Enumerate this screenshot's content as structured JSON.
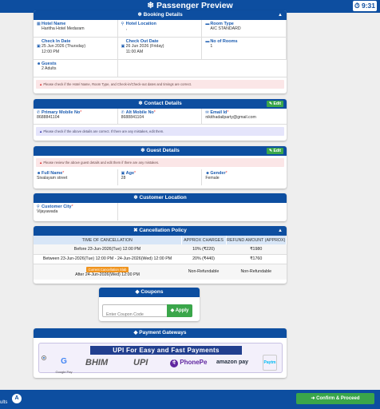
{
  "header": {
    "title": "❄ Passenger Preview",
    "timer": "9:31"
  },
  "booking": {
    "heading": "❄ Booking Details",
    "hotel_name_label": "Hotel Name",
    "hotel_name": "Haritha Hotel Medaram",
    "hotel_location_label": "Hotel Location",
    "hotel_location": ",",
    "room_type_label": "Room Type",
    "room_type": "A/C STANDARD",
    "checkin_label": "Check In Date",
    "checkin_date": "25 Jun 2026 (Thursday)",
    "checkin_time": "12:00 PM",
    "checkout_label": "Check Out Date",
    "checkout_date": "26 Jun 2026 (Friday)",
    "checkout_time": "11:00 AM",
    "rooms_label": "No of Rooms",
    "rooms": "1",
    "guests_label": "Guests",
    "guests": "2 Adults",
    "note": "Please check if the Hotel Name, Room Type, and Check-in/Check-out dates and timings are correct."
  },
  "contact": {
    "heading": "❄ Contact Details",
    "edit": "Edit",
    "mobile_label": "Primary Mobile No",
    "mobile": "8688841104",
    "alt_label": "Alt Mobile No",
    "alt": "8688841104",
    "email_label": "Email Id",
    "email": "nikithadailparty@gmail.com",
    "note": "Please check if the above details are correct. If there are any mistakes, edit them."
  },
  "guest": {
    "heading": "❄ Guest Details",
    "edit": "Edit",
    "note": "Please review the above guest details and edit them if there are any mistakes.",
    "name_label": "Full Name",
    "name": "Sivalayam street",
    "age_label": "Age",
    "age": "28",
    "gender_label": "Gender",
    "gender": "Female"
  },
  "location": {
    "heading": "❄ Customer Location",
    "city_label": "Customer City",
    "city": "Vijayawada"
  },
  "cancellation": {
    "heading": "✖ Cancellation Policy",
    "columns": [
      "TIME OF CANCELLATION",
      "APPROX CHARGES",
      "REFUND AMOUNT (APPROX)"
    ],
    "rows": [
      {
        "time": "Before 23-Jun-2026(Tue) 12:00 PM",
        "charge": "10% (₹220)",
        "refund": "₹1980"
      },
      {
        "time": "Between 23-Jun-2026(Tue) 12:00 PM - 24-Jun-2026(Wed) 12:00 PM",
        "charge": "20% (₹440)",
        "refund": "₹1760"
      },
      {
        "badge": "Current Cancellation Slab",
        "time": "After 24-Jun-2026(Wed) 12:00 PM",
        "charge": "Non-Refundable",
        "refund": "Non-Refundable"
      }
    ]
  },
  "coupons": {
    "heading": "◆ Coupons",
    "placeholder": "Enter Coupon Code",
    "apply": "Apply"
  },
  "payment": {
    "heading": "◆ Payment Gateways",
    "banner": "UPI For Easy and Fast Payments",
    "logos": [
      "Google Pay",
      "BHIM",
      "UPI",
      "PhonePe",
      "amazon pay",
      "Paytm"
    ]
  },
  "footer": {
    "confirm": "Confirm & Proceed",
    "side_label": "ults",
    "bubble": "A"
  },
  "colors": {
    "primary": "#0d4ea0",
    "success": "#3aa64a",
    "warning": "#f0941e"
  }
}
